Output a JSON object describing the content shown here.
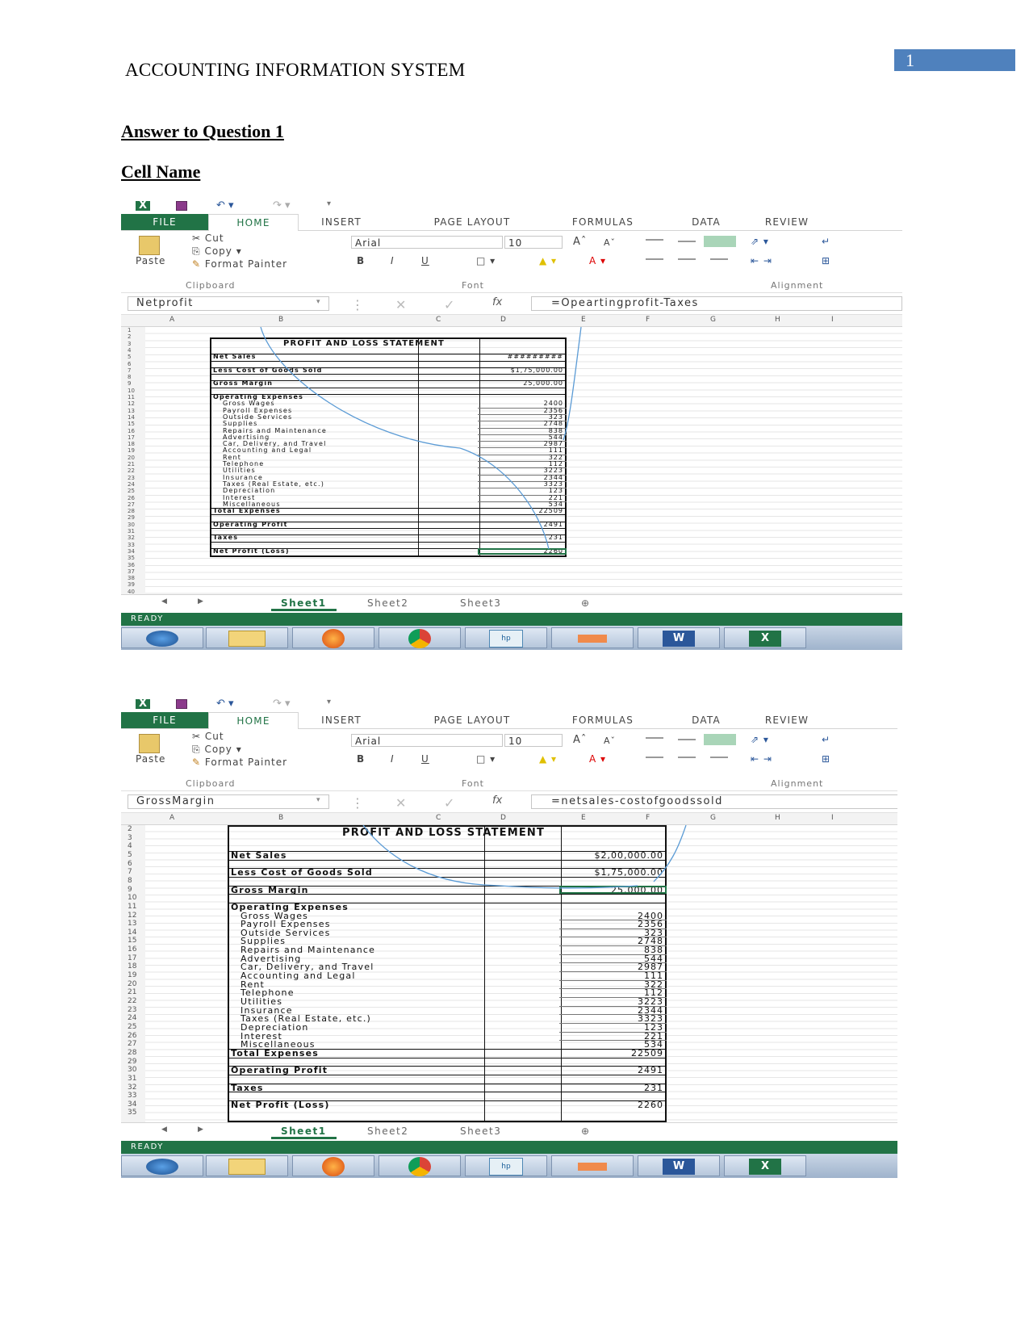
{
  "doc": {
    "running_head": "ACCOUNTING INFORMATION SYSTEM",
    "page_number": "1",
    "heading1": "Answer to Question 1",
    "heading2": "Cell Name"
  },
  "excel": {
    "tabs": [
      "FILE",
      "HOME",
      "INSERT",
      "PAGE LAYOUT",
      "FORMULAS",
      "DATA",
      "REVIEW"
    ],
    "clipboard": {
      "paste": "Paste",
      "cut": "Cut",
      "copy": "Copy",
      "format_painter": "Format Painter",
      "label": "Clipboard"
    },
    "font": {
      "name": "Arial",
      "size": "10",
      "label": "Font",
      "bold": "B",
      "italic": "I",
      "underline": "U"
    },
    "alignment_label": "Alignment",
    "fx": "fx",
    "sheets": [
      "Sheet1",
      "Sheet2",
      "Sheet3"
    ],
    "status": "READY",
    "columns": [
      "A",
      "B",
      "C",
      "D",
      "E",
      "F",
      "G",
      "H",
      "I"
    ]
  },
  "shot1": {
    "name_box": "Netprofit",
    "formula": "=Opeartingprofit-Taxes",
    "title": "PROFIT AND LOSS STATEMENT",
    "net_sales_label": "Net Sales",
    "net_sales_value": "#########",
    "cogs_label": "Less Cost of Goods Sold",
    "cogs_value": "$1,75,000.00",
    "gross_margin_label": "Gross Margin",
    "gross_margin_value": "25,000.00",
    "opex_label": "Operating Expenses",
    "items": [
      {
        "label": "Gross Wages",
        "value": "2400"
      },
      {
        "label": "Payroll Expenses",
        "value": "2356"
      },
      {
        "label": "Outside Services",
        "value": "323"
      },
      {
        "label": "Supplies",
        "value": "2748"
      },
      {
        "label": "Repairs and Maintenance",
        "value": "838"
      },
      {
        "label": "Advertising",
        "value": "544"
      },
      {
        "label": "Car, Delivery, and Travel",
        "value": "2987"
      },
      {
        "label": "Accounting and Legal",
        "value": "111"
      },
      {
        "label": "Rent",
        "value": "322"
      },
      {
        "label": "Telephone",
        "value": "112"
      },
      {
        "label": "Utilities",
        "value": "3223"
      },
      {
        "label": "Insurance",
        "value": "2344"
      },
      {
        "label": "Taxes (Real Estate, etc.)",
        "value": "3323"
      },
      {
        "label": "Depreciation",
        "value": "123"
      },
      {
        "label": "Interest",
        "value": "221"
      },
      {
        "label": "Miscellaneous",
        "value": "534"
      }
    ],
    "total_label": "Total Expenses",
    "total_value": "22509",
    "op_profit_label": "Operating Profit",
    "op_profit_value": "2491",
    "taxes_label": "Taxes",
    "taxes_value": "231",
    "net_profit_label": "Net Profit (Loss)",
    "net_profit_value": "2260"
  },
  "shot2": {
    "name_box": "GrossMargin",
    "formula": "=netsales-costofgoodssold",
    "title": "PROFIT AND LOSS STATEMENT",
    "net_sales_label": "Net Sales",
    "net_sales_value": "$2,00,000.00",
    "cogs_label": "Less Cost of Goods Sold",
    "cogs_value": "$1,75,000.00",
    "gross_margin_label": "Gross Margin",
    "gross_margin_value": "25,000.00",
    "opex_label": "Operating Expenses",
    "items": [
      {
        "label": "Gross Wages",
        "value": "2400"
      },
      {
        "label": "Payroll Expenses",
        "value": "2356"
      },
      {
        "label": "Outside Services",
        "value": "323"
      },
      {
        "label": "Supplies",
        "value": "2748"
      },
      {
        "label": "Repairs and Maintenance",
        "value": "838"
      },
      {
        "label": "Advertising",
        "value": "544"
      },
      {
        "label": "Car, Delivery, and Travel",
        "value": "2987"
      },
      {
        "label": "Accounting and Legal",
        "value": "111"
      },
      {
        "label": "Rent",
        "value": "322"
      },
      {
        "label": "Telephone",
        "value": "112"
      },
      {
        "label": "Utilities",
        "value": "3223"
      },
      {
        "label": "Insurance",
        "value": "2344"
      },
      {
        "label": "Taxes (Real Estate, etc.)",
        "value": "3323"
      },
      {
        "label": "Depreciation",
        "value": "123"
      },
      {
        "label": "Interest",
        "value": "221"
      },
      {
        "label": "Miscellaneous",
        "value": "534"
      }
    ],
    "total_label": "Total Expenses",
    "total_value": "22509",
    "op_profit_label": "Operating Profit",
    "op_profit_value": "2491",
    "taxes_label": "Taxes",
    "taxes_value": "231",
    "net_profit_label": "Net Profit (Loss)",
    "net_profit_value": "2260"
  },
  "taskbar_icons": [
    "windows-start-icon",
    "file-explorer-icon",
    "firefox-icon",
    "chrome-icon",
    "hp-icon",
    "app-icon",
    "word-icon",
    "excel-icon"
  ]
}
